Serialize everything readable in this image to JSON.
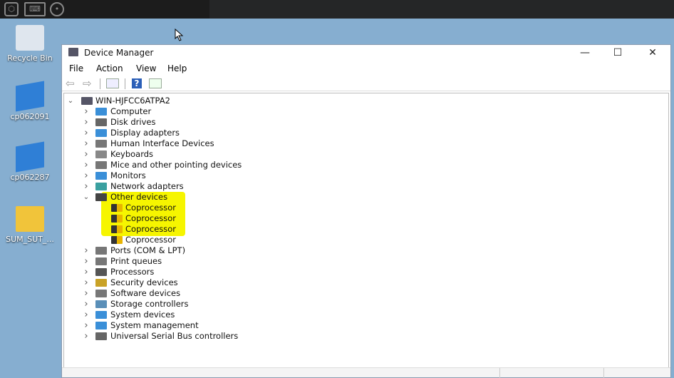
{
  "desktop": {
    "icons": [
      {
        "label": "Recycle Bin",
        "icon": "recycle-bin-icon"
      },
      {
        "label": "cp062091",
        "icon": "package-icon"
      },
      {
        "label": "cp062287",
        "icon": "package-icon"
      },
      {
        "label": "SUM_SUT_...",
        "icon": "folder-icon"
      }
    ]
  },
  "window": {
    "title": "Device Manager",
    "minimize": "—",
    "maximize": "☐",
    "close": "✕"
  },
  "menu": [
    "File",
    "Action",
    "View",
    "Help"
  ],
  "toolbar": {
    "back": "⇦",
    "forward": "⇨",
    "help": "?"
  },
  "tree": {
    "root": "WIN-HJFCC6ATPA2",
    "items": [
      {
        "label": "Computer",
        "color": "#3a8fd8"
      },
      {
        "label": "Disk drives",
        "color": "#666"
      },
      {
        "label": "Display adapters",
        "color": "#3a8fd8"
      },
      {
        "label": "Human Interface Devices",
        "color": "#777"
      },
      {
        "label": "Keyboards",
        "color": "#888"
      },
      {
        "label": "Mice and other pointing devices",
        "color": "#777"
      },
      {
        "label": "Monitors",
        "color": "#3a8fd8"
      },
      {
        "label": "Network adapters",
        "color": "#3aa0a0"
      },
      {
        "label": "Other devices",
        "color": "#444",
        "expanded": true,
        "children": [
          "Coprocessor",
          "Coprocessor",
          "Coprocessor",
          "Coprocessor"
        ]
      },
      {
        "label": "Ports (COM & LPT)",
        "color": "#777"
      },
      {
        "label": "Print queues",
        "color": "#777"
      },
      {
        "label": "Processors",
        "color": "#555"
      },
      {
        "label": "Security devices",
        "color": "#c9a227"
      },
      {
        "label": "Software devices",
        "color": "#777"
      },
      {
        "label": "Storage controllers",
        "color": "#5a8fb8"
      },
      {
        "label": "System devices",
        "color": "#3a8fd8"
      },
      {
        "label": "System management",
        "color": "#3a8fd8"
      },
      {
        "label": "Universal Serial Bus controllers",
        "color": "#666"
      }
    ]
  },
  "highlight_color": "#f6f500"
}
